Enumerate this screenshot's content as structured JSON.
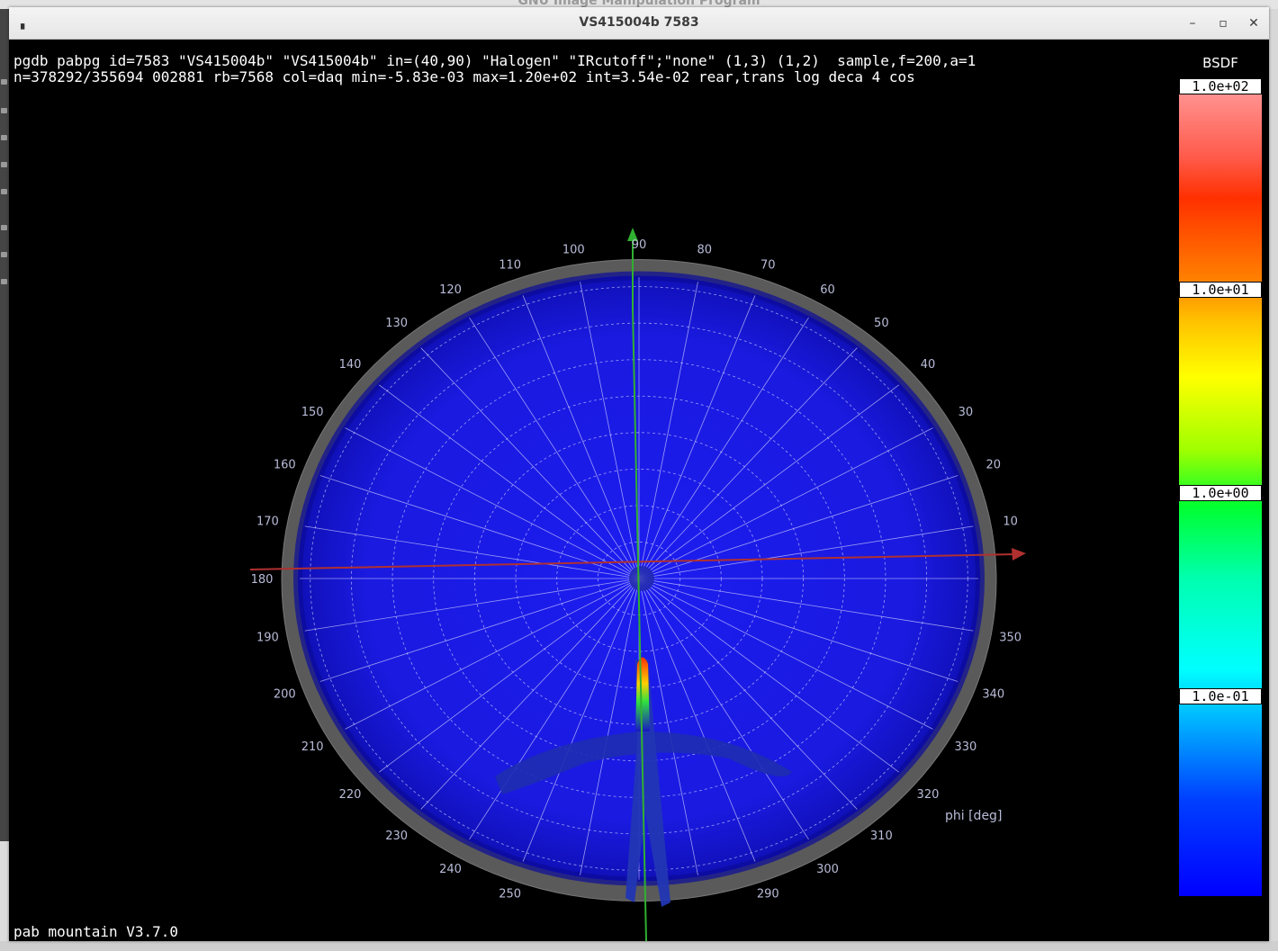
{
  "background": {
    "gimp_title": "GNU Image Manipulation Program"
  },
  "window": {
    "title": "VS415004b 7583",
    "icon": "app-icon"
  },
  "info": {
    "line1": "pgdb pabpg id=7583 \"VS415004b\" \"VS415004b\" in=(40,90) \"Halogen\" \"IRcutoff\";\"none\" (1,3) (1,2)  sample,f=200,a=1",
    "line2": "n=378292/355694 002881 rb=7568 col=daq min=-5.83e-03 max=1.20e+02 int=3.54e-02 rear,trans log deca 4 cos"
  },
  "footer": "pab mountain V3.7.0",
  "colorbar": {
    "title": "BSDF",
    "labels": [
      "1.0e+02",
      "1.0e+01",
      "1.0e+00",
      "1.0e-01"
    ]
  },
  "polar_plot": {
    "axis_label": "phi [deg]",
    "angle_ticks": [
      10,
      20,
      30,
      40,
      50,
      60,
      70,
      80,
      90,
      100,
      110,
      120,
      130,
      140,
      150,
      160,
      170,
      180,
      190,
      200,
      210,
      220,
      230,
      240,
      250,
      290,
      300,
      310,
      320,
      330,
      340,
      350
    ],
    "colors": {
      "surface": "#1818e8",
      "rim": "#5a5a5a",
      "grid": "#c8c8ff",
      "x_axis": "#b03030",
      "y_axis": "#30b030",
      "peak": "#ff4000"
    }
  }
}
